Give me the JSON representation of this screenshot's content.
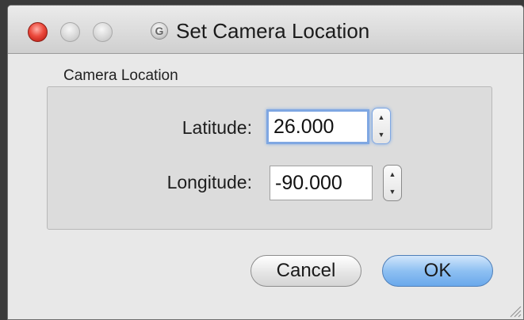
{
  "window": {
    "title": "Set Camera Location",
    "app_icon": "G"
  },
  "group": {
    "label": "Camera Location"
  },
  "fields": {
    "latitude": {
      "label": "Latitude:",
      "value": "26.000"
    },
    "longitude": {
      "label": "Longitude:",
      "value": "-90.000"
    }
  },
  "buttons": {
    "cancel": "Cancel",
    "ok": "OK"
  },
  "icons": {
    "close": "close-icon",
    "minimize": "minimize-icon",
    "zoom": "zoom-icon",
    "stepper_up": "▲",
    "stepper_down": "▼"
  },
  "colors": {
    "ok_button": "#8ec0f2",
    "focus_ring": "#7fa7e2",
    "close_button": "#ec4a3d"
  }
}
